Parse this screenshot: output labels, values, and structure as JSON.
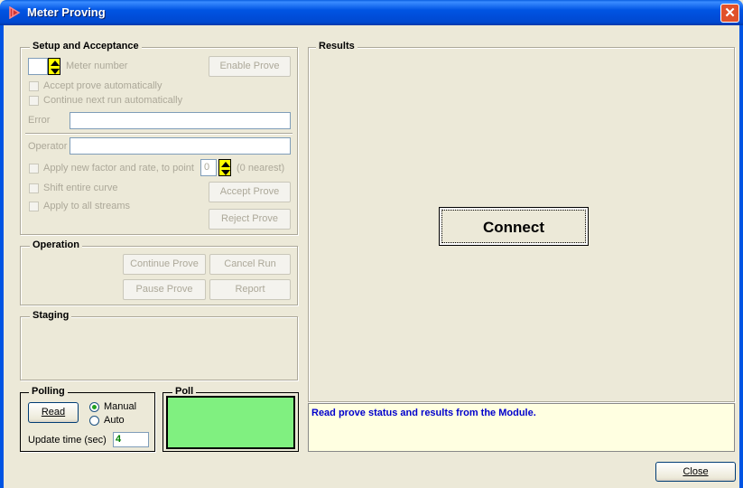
{
  "window": {
    "title": "Meter Proving",
    "close_glyph": "✕"
  },
  "setup": {
    "legend": "Setup and Acceptance",
    "meter_number_label": "Meter number",
    "enable_prove": "Enable Prove",
    "accept_auto": "Accept prove automatically",
    "continue_auto": "Continue next run automatically",
    "error_label": "Error",
    "error_value": "",
    "operator_label": "Operator",
    "operator_value": "",
    "apply_factor": "Apply new factor and rate, to point",
    "point_value": "0",
    "nearest_note": "(0 nearest)",
    "shift_curve": "Shift entire curve",
    "apply_streams": "Apply to all streams",
    "accept_prove": "Accept Prove",
    "reject_prove": "Reject Prove"
  },
  "operation": {
    "legend": "Operation",
    "continue_prove": "Continue Prove",
    "cancel_run": "Cancel Run",
    "pause_prove": "Pause Prove",
    "report": "Report"
  },
  "staging": {
    "legend": "Staging"
  },
  "polling": {
    "legend": "Polling",
    "read": "Read",
    "manual": "Manual",
    "auto": "Auto",
    "mode_selected": "Manual",
    "update_label": "Update time (sec)",
    "update_value": "4"
  },
  "poll": {
    "legend": "Poll",
    "indicator_color": "#80f080"
  },
  "results": {
    "legend": "Results",
    "connect": "Connect"
  },
  "status": {
    "message": "Read prove status and results from the Module.",
    "color": "#0000cc",
    "bg": "#ffffe1"
  },
  "footer": {
    "close": "Close"
  },
  "icons": {
    "spin_up_down": "spin-updown-icon",
    "close": "close-icon",
    "app": "app-icon"
  }
}
